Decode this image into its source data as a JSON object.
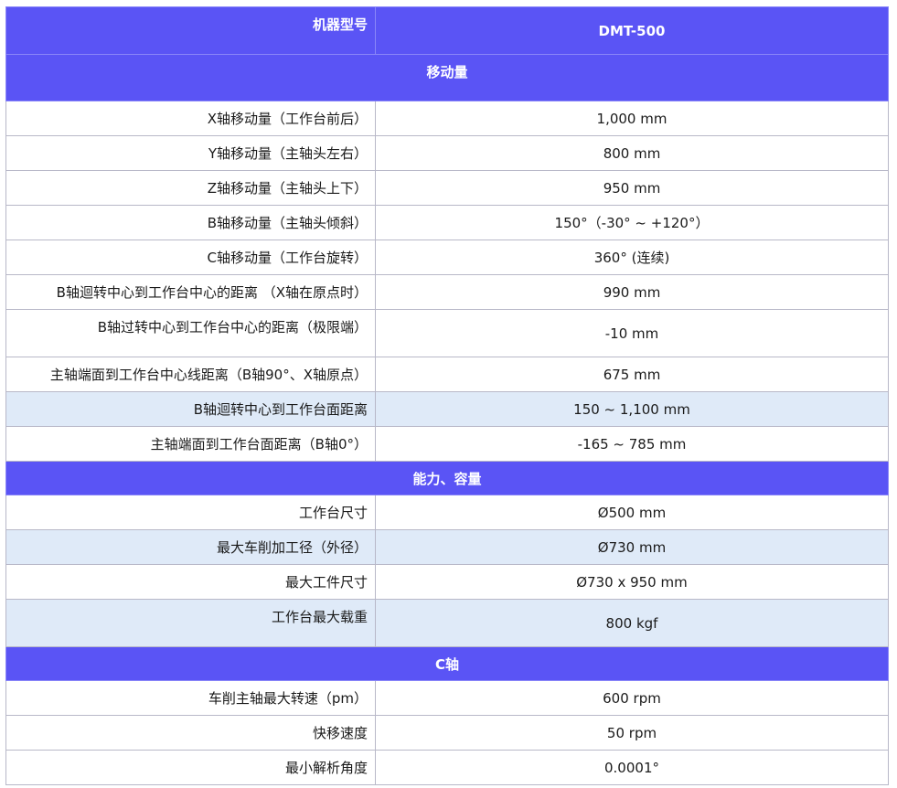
{
  "header": {
    "label": "机器型号",
    "model": "DMT-500"
  },
  "sections": [
    {
      "title": "移动量",
      "rows": [
        {
          "label": "X轴移动量（工作台前后）",
          "value": "1,000 mm"
        },
        {
          "label": "Y轴移动量（主轴头左右）",
          "value": "800 mm"
        },
        {
          "label": "Z轴移动量（主轴头上下）",
          "value": "950 mm"
        },
        {
          "label": "B轴移动量（主轴头倾斜）",
          "value": "150°（-30° ~ +120°）"
        },
        {
          "label": "C轴移动量（工作台旋转）",
          "value": "360° (连续)"
        },
        {
          "label": "B轴迴转中心到工作台中心的距离 （X轴在原点时）",
          "value": "990 mm"
        },
        {
          "label": "B轴过转中心到工作台中心的距离（极限端）",
          "value": "-10 mm"
        },
        {
          "label": "主轴端面到工作台中心线距离（B轴90°、X轴原点）",
          "value": "675 mm"
        },
        {
          "label": "B轴迴转中心到工作台面距离",
          "value": "150 ~ 1,100 mm"
        },
        {
          "label": "主轴端面到工作台面距离（B轴0°）",
          "value": "-165 ~ 785 mm"
        }
      ]
    },
    {
      "title": "能力、容量",
      "rows": [
        {
          "label": "工作台尺寸",
          "value": "Ø500  mm"
        },
        {
          "label": "最大车削加工径（外径）",
          "value": "Ø730  mm"
        },
        {
          "label": "最大工件尺寸",
          "value": "Ø730 x 950 mm"
        },
        {
          "label": "工作台最大载重",
          "value": "800 kgf"
        }
      ]
    },
    {
      "title": "C轴",
      "rows": [
        {
          "label": "车削主轴最大转速（pm）",
          "value": "600 rpm"
        },
        {
          "label": "快移速度",
          "value": "50 rpm"
        },
        {
          "label": "最小解析角度",
          "value": "0.0001°"
        }
      ]
    }
  ]
}
